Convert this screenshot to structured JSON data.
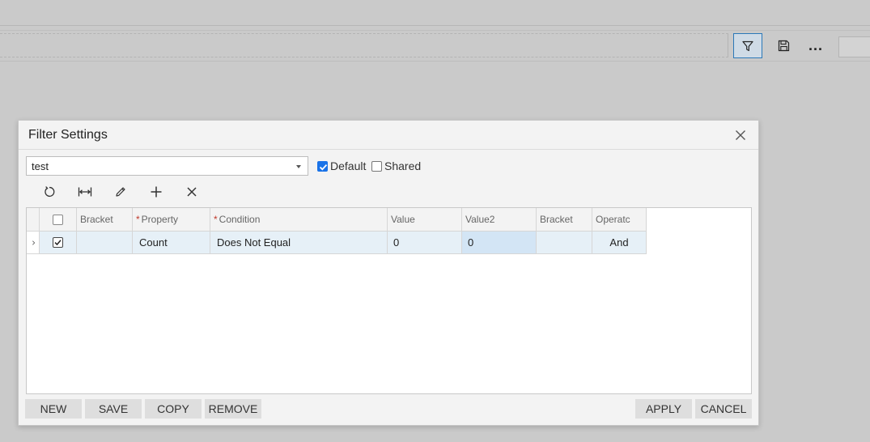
{
  "toolbar": {
    "filter_icon": "filter-icon",
    "save_icon": "save-icon",
    "more_label": "..."
  },
  "dialog": {
    "title": "Filter Settings",
    "filter_select": {
      "value": "test"
    },
    "default_label": "Default",
    "default_checked": true,
    "shared_label": "Shared",
    "shared_checked": false,
    "toolbar_icons": [
      "refresh-icon",
      "fit-columns-icon",
      "edit-icon",
      "add-icon",
      "delete-icon"
    ],
    "grid": {
      "columns": [
        {
          "label": "Bracket",
          "required": false
        },
        {
          "label": "Property",
          "required": true
        },
        {
          "label": "Condition",
          "required": true
        },
        {
          "label": "Value",
          "required": false
        },
        {
          "label": "Value2",
          "required": false
        },
        {
          "label": "Bracket",
          "required": false
        },
        {
          "label": "Operatc",
          "required": false
        }
      ],
      "rows": [
        {
          "selected": true,
          "bracket_open": "",
          "property": "Count",
          "condition": "Does Not Equal",
          "value": "0",
          "value2": "0",
          "bracket_close": "",
          "operator": "And"
        }
      ]
    },
    "buttons": {
      "new": "NEW",
      "save": "SAVE",
      "copy": "COPY",
      "remove": "REMOVE",
      "apply": "APPLY",
      "cancel": "CANCEL"
    }
  },
  "colors": {
    "accent": "#2b78b8",
    "checkbox_on": "#1a73e8",
    "required": "#c0392b",
    "row_highlight": "#e6f0f7"
  }
}
